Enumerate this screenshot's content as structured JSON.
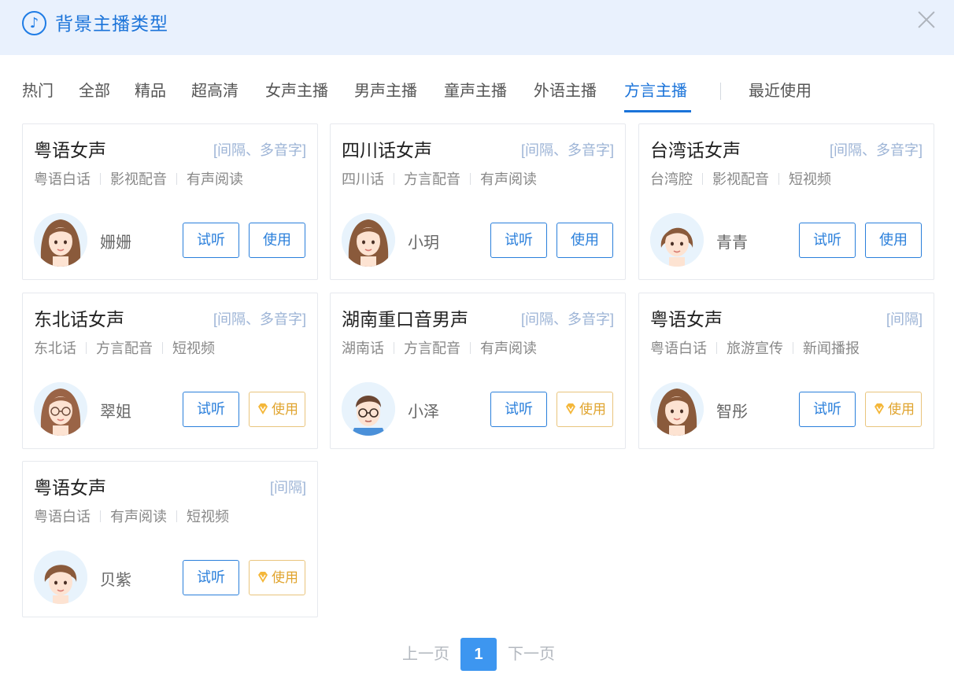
{
  "header": {
    "title": "背景主播类型",
    "icon": "music-note-icon"
  },
  "tabs": [
    {
      "label": "热门",
      "active": false
    },
    {
      "label": "全部",
      "active": false
    },
    {
      "label": "精品",
      "active": false
    },
    {
      "label": "超高清",
      "active": false
    },
    {
      "label": "女声主播",
      "active": false
    },
    {
      "label": "男声主播",
      "active": false
    },
    {
      "label": "童声主播",
      "active": false
    },
    {
      "label": "外语主播",
      "active": false
    },
    {
      "label": "方言主播",
      "active": true
    },
    {
      "label": "最近使用",
      "active": false
    }
  ],
  "cards": [
    {
      "title": "粤语女声",
      "flags": "[间隔、多音字]",
      "tags": [
        "粤语白话",
        "影视配音",
        "有声阅读"
      ],
      "name": "姗姗",
      "try_label": "试听",
      "use_label": "使用",
      "vip": false,
      "avatar": "female-avatar-long-hair"
    },
    {
      "title": "四川话女声",
      "flags": "[间隔、多音字]",
      "tags": [
        "四川话",
        "方言配音",
        "有声阅读"
      ],
      "name": "小玥",
      "try_label": "试听",
      "use_label": "使用",
      "vip": false,
      "avatar": "female-avatar-long-hair"
    },
    {
      "title": "台湾话女声",
      "flags": "[间隔、多音字]",
      "tags": [
        "台湾腔",
        "影视配音",
        "短视频"
      ],
      "name": "青青",
      "try_label": "试听",
      "use_label": "使用",
      "vip": false,
      "avatar": "female-avatar-short-hair"
    },
    {
      "title": "东北话女声",
      "flags": "[间隔、多音字]",
      "tags": [
        "东北话",
        "方言配音",
        "短视频"
      ],
      "name": "翠姐",
      "try_label": "试听",
      "use_label": "使用",
      "vip": true,
      "avatar": "female-avatar-glasses"
    },
    {
      "title": "湖南重口音男声",
      "flags": "[间隔、多音字]",
      "tags": [
        "湖南话",
        "方言配音",
        "有声阅读"
      ],
      "name": "小泽",
      "try_label": "试听",
      "use_label": "使用",
      "vip": true,
      "avatar": "male-avatar-glasses"
    },
    {
      "title": "粤语女声",
      "flags": "[间隔]",
      "tags": [
        "粤语白话",
        "旅游宣传",
        "新闻播报"
      ],
      "name": "智彤",
      "try_label": "试听",
      "use_label": "使用",
      "vip": true,
      "avatar": "female-avatar-long-hair"
    },
    {
      "title": "粤语女声",
      "flags": "[间隔]",
      "tags": [
        "粤语白话",
        "有声阅读",
        "短视频"
      ],
      "name": "贝紫",
      "try_label": "试听",
      "use_label": "使用",
      "vip": true,
      "avatar": "female-avatar-ponytail"
    }
  ],
  "pagination": {
    "prev_label": "上一页",
    "current": "1",
    "next_label": "下一页"
  },
  "colors": {
    "accent": "#1a73d9",
    "header_bg": "#e9f1fd",
    "vip": "#e0a42e",
    "page_active": "#3d96f0"
  }
}
